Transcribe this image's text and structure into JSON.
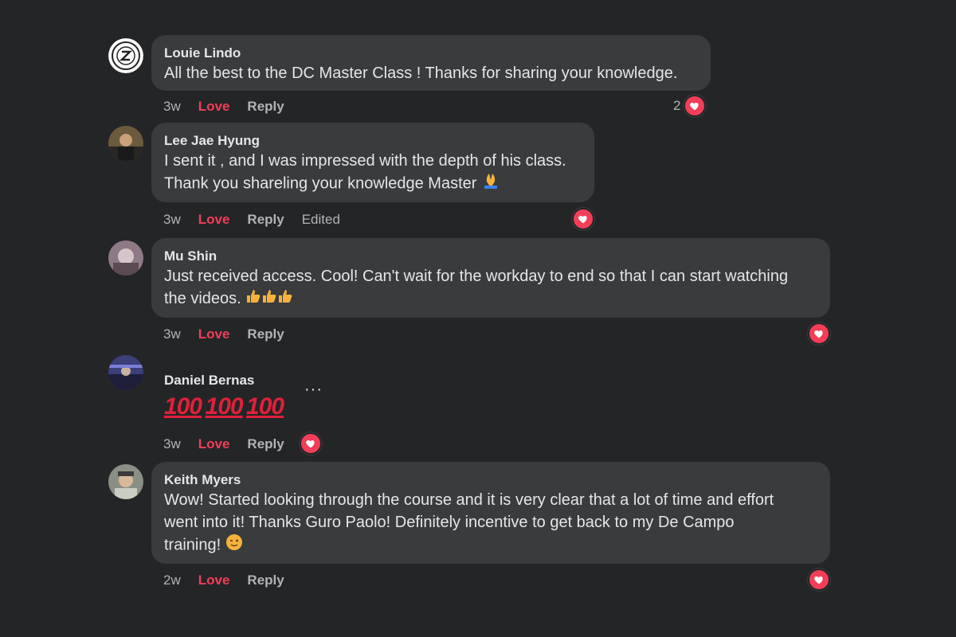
{
  "comments": [
    {
      "author": "Louie Lindo",
      "text": "All the best to the DC Master Class ! Thanks for sharing your knowledge.",
      "time": "3w",
      "love": "Love",
      "reply": "Reply",
      "reaction_count": "2",
      "avatar_icon": "badge-logo-icon"
    },
    {
      "author": "Lee Jae Hyung",
      "text_lines": [
        "I sent it , and I was impressed with the depth of his class.",
        "Thank you shareling your knowledge Master"
      ],
      "emoji": "folded-hands-icon",
      "time": "3w",
      "love": "Love",
      "reply": "Reply",
      "edited": "Edited"
    },
    {
      "author": "Mu Shin",
      "text_lines": [
        "Just received access. Cool! Can't wait for the workday to end so that I can start watching",
        "the videos."
      ],
      "emoji": "thumbs-up-icon",
      "time": "3w",
      "love": "Love",
      "reply": "Reply"
    },
    {
      "author": "Daniel Bernas",
      "hundreds": [
        "100",
        "100",
        "100"
      ],
      "more": "···",
      "time": "3w",
      "love": "Love",
      "reply": "Reply"
    },
    {
      "author": "Keith Myers",
      "text_lines": [
        "Wow! Started looking through the course and it is very clear that a lot of time and effort",
        "went into it! Thanks Guro Paolo! Definitely incentive to get back to my De Campo",
        "training!"
      ],
      "emoji": "winking-face-icon",
      "time": "2w",
      "love": "Love",
      "reply": "Reply"
    }
  ],
  "colors": {
    "background": "#242526",
    "bubble": "#3a3b3c",
    "love": "#f33e58",
    "muted": "#b0b3b8"
  }
}
